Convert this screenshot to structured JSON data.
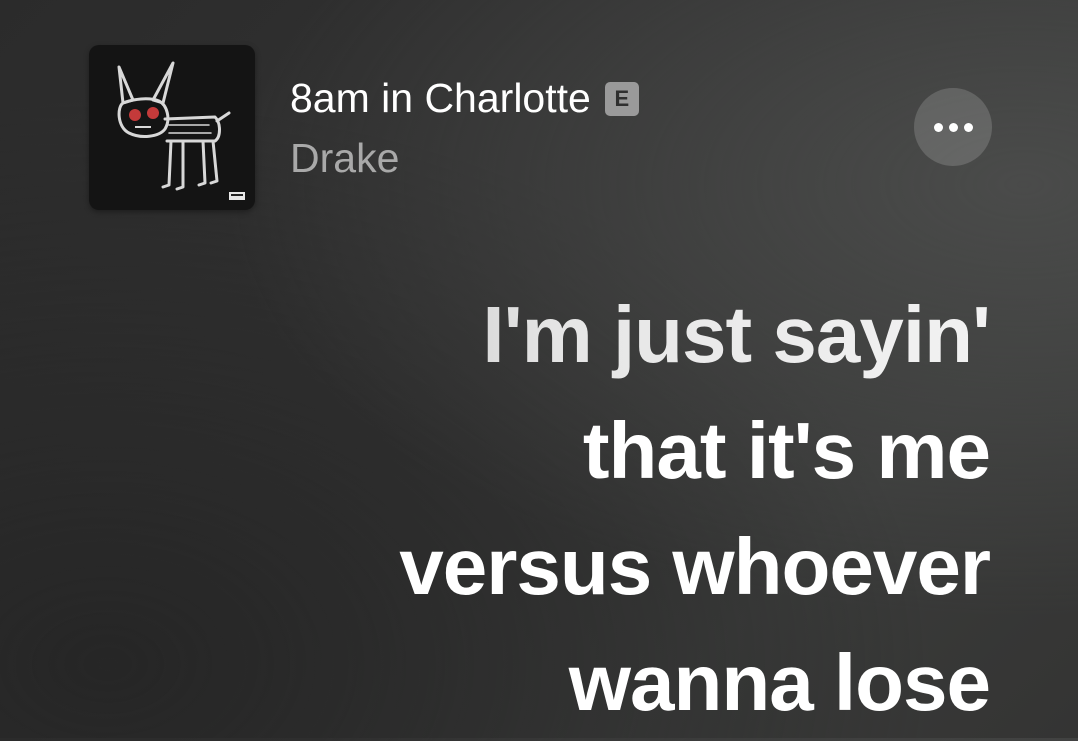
{
  "now_playing": {
    "title": "8am in Charlotte",
    "explicit_badge": "E",
    "artist": "Drake",
    "artwork_icon": "album-artwork-dog-drawing"
  },
  "controls": {
    "more_icon": "ellipsis-icon"
  },
  "lyrics": {
    "lines": [
      "I'm just sayin'",
      "that it's me",
      "versus whoever",
      "wanna lose"
    ]
  },
  "colors": {
    "title": "#ffffff",
    "artist": "#a9a9a9",
    "badge": "#9a9a9a",
    "lyrics": "#ffffff"
  }
}
